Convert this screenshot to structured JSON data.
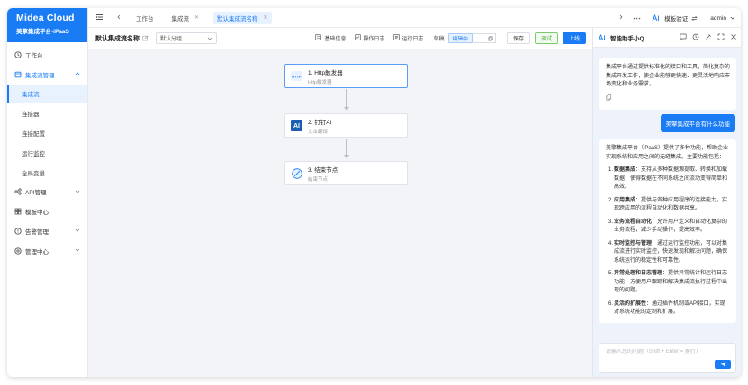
{
  "brand": {
    "logo": "Midea Cloud",
    "subtitle": "美擎集成平台-iPaaS"
  },
  "sidebar": {
    "items": [
      {
        "label": "工作台",
        "icon": "workbench-icon"
      },
      {
        "label": "集成流管理",
        "icon": "flow-management-icon",
        "expanded": true,
        "children": [
          "集成流",
          "连接器",
          "连接配置",
          "运行监控",
          "全局变量"
        ],
        "active_child": "集成流"
      },
      {
        "label": "API管理",
        "icon": "api-icon"
      },
      {
        "label": "模板中心",
        "icon": "template-icon"
      },
      {
        "label": "告警管理",
        "icon": "alarm-icon"
      },
      {
        "label": "管理中心",
        "icon": "admin-center-icon"
      }
    ]
  },
  "tabs": [
    {
      "label": "工作台",
      "closable": false,
      "active": false
    },
    {
      "label": "集成流",
      "closable": true,
      "active": false
    },
    {
      "label": "默认集成流名称",
      "closable": true,
      "active": true
    }
  ],
  "topbar": {
    "verify_label": "模板验证",
    "user": "admin"
  },
  "toolbar": {
    "flow_name": "默认集成流名称",
    "group_value": "默认分组",
    "links": [
      "基础信息",
      "操作日志",
      "运行日志"
    ],
    "env_label": "草稿",
    "env_pill": "编辑中",
    "save_label": "保存",
    "debug_label": "调试",
    "online_label": "上线"
  },
  "flow_nodes": [
    {
      "title": "1. Http触发器",
      "subtitle": "Http触发器",
      "icon": "http-icon",
      "icon_color": "#1a7cf5"
    },
    {
      "title": "2. 钉钉AI",
      "subtitle": "文本翻译",
      "icon": "ai-icon",
      "icon_color": "#1a5fb4"
    },
    {
      "title": "3. 结束节点",
      "subtitle": "结束节点",
      "icon": "end-icon",
      "icon_color": "#1a7cf5"
    }
  ],
  "assistant": {
    "title": "智能助手小Q",
    "intro": "集成平台通过提供标准化的接口和工具，简化复杂的集成开发工作，使企业能够更快速、更灵活地响应市场变化和业务需求。",
    "user_question": "美擎集成平台有什么功能",
    "answer_intro": "美擎集成平台（iPaaS）提供了多种功能，帮助企业实现系统和应用之间的无缝集成。主要功能包括：",
    "features": [
      {
        "name": "数据集成",
        "desc": "：支持从多种数据源提取、转换和加载数据，使得数据在不同系统之间流动变得简单和高效。"
      },
      {
        "name": "应用集成",
        "desc": "：提供与各种应用程序的连接能力，实现跨应用的流程自动化和数据共享。"
      },
      {
        "name": "业务流程自动化",
        "desc": "：允许用户定义和自动化复杂的业务流程，减少手动操作，提高效率。"
      },
      {
        "name": "实时监控与管理",
        "desc": "：通过运行监控功能，可以对集成流进行实时监控，快速发现和解决问题，确保系统运行的稳定性和可靠性。"
      },
      {
        "name": "异常处理和日志管理",
        "desc": "：提供异常统计和运行日志功能，方便用户跟踪和解决集成流执行过程中出现的问题。"
      },
      {
        "name": "灵活的扩展性",
        "desc": "：通过插件机制或API接口，实现对系统功能的定制和扩展。"
      }
    ],
    "input_placeholder": "请输入您的问题（Shift + Enter = 换行）"
  },
  "colors": {
    "accent": "#1a7cf5",
    "debug_green": "#3da62d"
  }
}
